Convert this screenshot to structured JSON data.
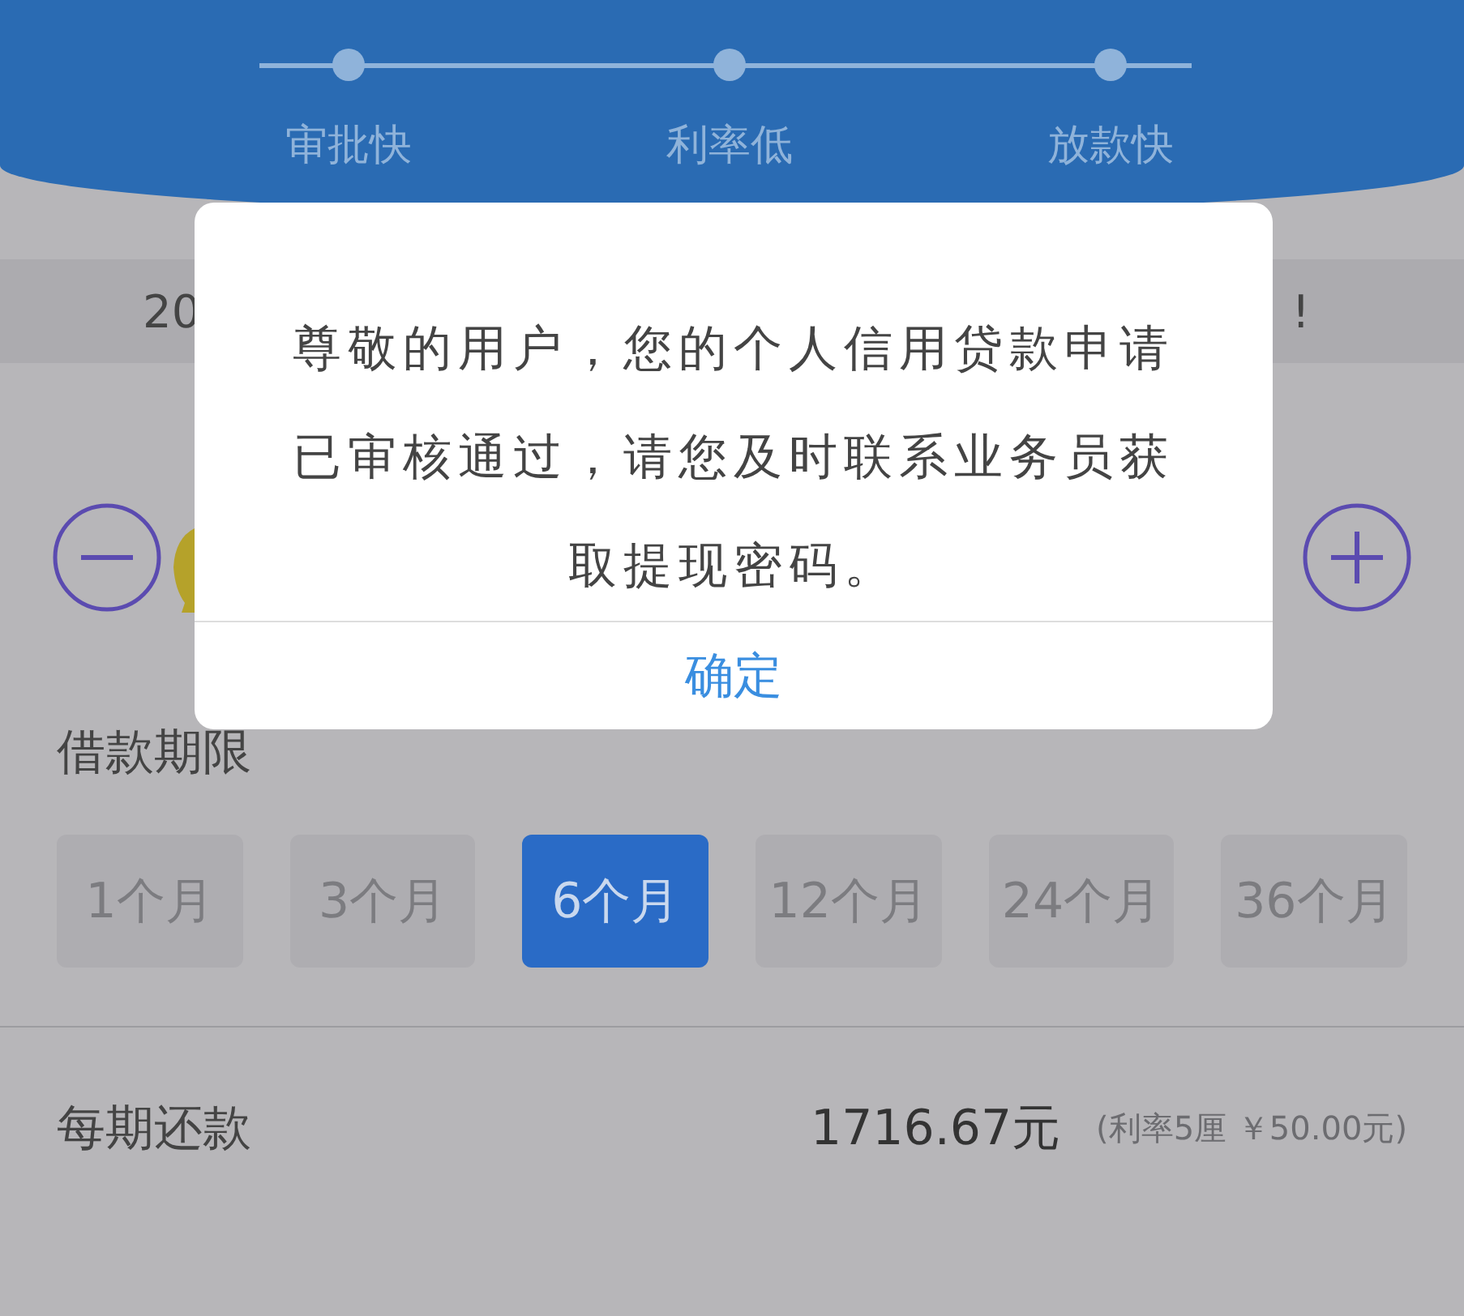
{
  "steps": [
    {
      "label": "审批快"
    },
    {
      "label": "利率低"
    },
    {
      "label": "放款快"
    }
  ],
  "notice": {
    "start": "20",
    "end": "!"
  },
  "term_section": {
    "title": "借款期限"
  },
  "terms": [
    {
      "label": "1个月",
      "selected": false
    },
    {
      "label": "3个月",
      "selected": false
    },
    {
      "label": "6个月",
      "selected": true
    },
    {
      "label": "12个月",
      "selected": false
    },
    {
      "label": "24个月",
      "selected": false
    },
    {
      "label": "36个月",
      "selected": false
    }
  ],
  "repayment": {
    "label": "每期还款",
    "amount": "1716.67元",
    "detail": "(利率5厘 ￥50.00元)"
  },
  "dialog": {
    "message": "尊敬的用户，您的个人信用贷款申请已审核通过，请您及时联系业务员获取提现密码。",
    "button": "确定"
  }
}
